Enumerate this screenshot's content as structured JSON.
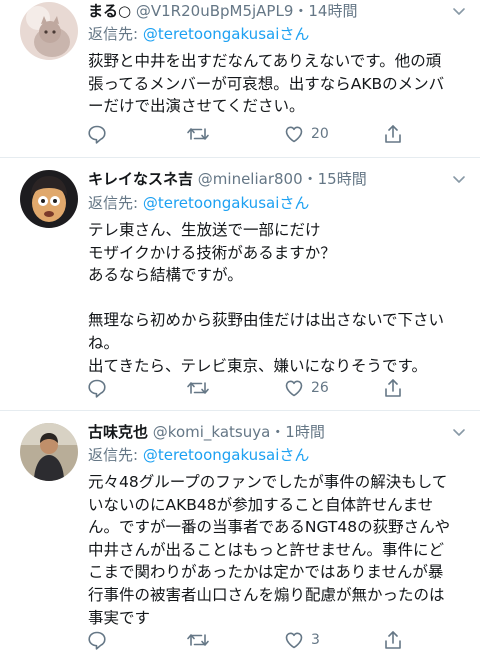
{
  "tweets": [
    {
      "name": "まる○",
      "handle": "@V1R20uBpM5jAPL9",
      "time": "・14時間",
      "reply_prefix": "返信先: ",
      "reply_mention": "@teretoongakusaiさん",
      "lines": [
        "荻野と中井を出すだなんてありえないです。他の頑",
        "張ってるメンバーが可哀想。出すならAKBのメンバ",
        "ーだけで出演させてください。"
      ],
      "likes": "20",
      "avatar_icon": "cat-avatar-icon"
    },
    {
      "name": "キレイなスネ吉",
      "handle": "@mineliar800",
      "time": "・15時間",
      "reply_prefix": "返信先: ",
      "reply_mention": "@teretoongakusaiさん",
      "lines": [
        "テレ東さん、生放送で一部にだけ",
        "モザイクかける技術があるますか？",
        "あるなら結構ですが。",
        "",
        "無理なら初めから荻野由佳だけは出さないで下さい",
        "ね。",
        "出てきたら、テレビ東京、嫌いになりそうです。"
      ],
      "likes": "26",
      "avatar_icon": "cartoon-character-avatar-icon"
    },
    {
      "name": "古味克也",
      "handle": "@komi_katsuya",
      "time": "・1時間",
      "reply_prefix": "返信先: ",
      "reply_mention": "@teretoongakusaiさん",
      "lines": [
        "元々48グループのファンでしたが事件の解決もして",
        "いないのにAKB48が参加すること自体許せんませ",
        "ん。ですが一番の当事者であるNGT48の荻野さんや",
        "中井さんが出ることはもっと許せません。事件にど",
        "こまで関わりがあったかは定かではありませんが暴",
        "行事件の被害者山口さんを煽り配慮が無かったのは",
        "事実です"
      ],
      "likes": "3",
      "avatar_icon": "person-photo-avatar-icon"
    }
  ],
  "colors": {
    "accent": "#1da1f2",
    "secondary_text": "#657786",
    "divider": "#e6ecf0"
  }
}
